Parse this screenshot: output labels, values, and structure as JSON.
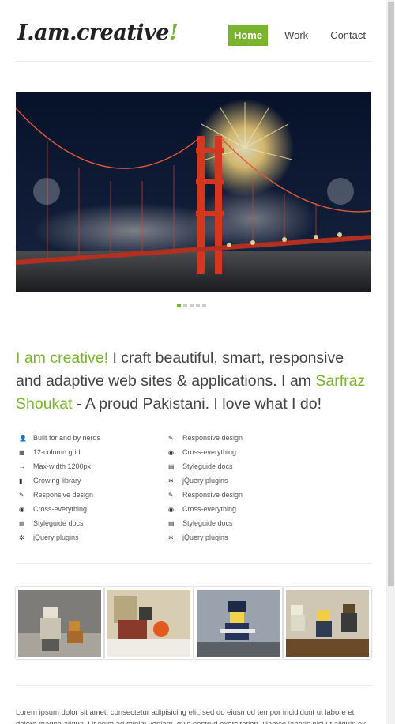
{
  "header": {
    "logo_text": "I.am.creative",
    "logo_mark": "!",
    "nav": [
      {
        "label": "Home",
        "active": true
      },
      {
        "label": "Work",
        "active": false
      },
      {
        "label": "Contact",
        "active": false
      }
    ]
  },
  "slider": {
    "image": "golden-gate-bridge-fireworks",
    "slide_count": 5,
    "active_slide": 1
  },
  "intro": {
    "part1": "I am creative!",
    "part2": " I craft beautiful, smart, responsive and adaptive web sites & applications. I am ",
    "name": "Sarfraz Shoukat",
    "part3": " - A proud Pakistani. I love what I do!"
  },
  "features": {
    "left": [
      {
        "icon": "user-icon",
        "glyph": "👤",
        "label": "Built for and by nerds"
      },
      {
        "icon": "grid-icon",
        "glyph": "▦",
        "label": "12-column grid"
      },
      {
        "icon": "resize-icon",
        "glyph": "↔",
        "label": "Max-width 1200px"
      },
      {
        "icon": "book-icon",
        "glyph": "▮",
        "label": "Growing library"
      },
      {
        "icon": "pencil-icon",
        "glyph": "✎",
        "label": "Responsive design"
      },
      {
        "icon": "eye-icon",
        "glyph": "◉",
        "label": "Cross-everything"
      },
      {
        "icon": "list-icon",
        "glyph": "▤",
        "label": "Styleguide docs"
      },
      {
        "icon": "cog-icon",
        "glyph": "✲",
        "label": "jQuery plugins"
      }
    ],
    "right": [
      {
        "icon": "pencil-icon",
        "glyph": "✎",
        "label": "Responsive design"
      },
      {
        "icon": "eye-icon",
        "glyph": "◉",
        "label": "Cross-everything"
      },
      {
        "icon": "list-icon",
        "glyph": "▤",
        "label": "Styleguide docs"
      },
      {
        "icon": "cog-icon",
        "glyph": "✲",
        "label": "jQuery plugins"
      },
      {
        "icon": "pencil-icon",
        "glyph": "✎",
        "label": "Responsive design"
      },
      {
        "icon": "eye-icon",
        "glyph": "◉",
        "label": "Cross-everything"
      },
      {
        "icon": "list-icon",
        "glyph": "▤",
        "label": "Styleguide docs"
      },
      {
        "icon": "cog-icon",
        "glyph": "✲",
        "label": "jQuery plugins"
      }
    ]
  },
  "thumbnails": [
    "lego-soldier-with-dog",
    "lego-crashed-vehicle",
    "lego-police-figure",
    "lego-soldiers-group"
  ],
  "footer": {
    "text": "Lorem ipsum dolor sit amet, consectetur adipisicing elit, sed do eiusmod tempor incididunt ut labore et dolore magna aliqua. Ut enim ad minim veniam, quis nostrud exercitation ullamco laboris nisi ut aliquip ex ea"
  },
  "colors": {
    "accent": "#7ab32e",
    "text": "#444444"
  }
}
